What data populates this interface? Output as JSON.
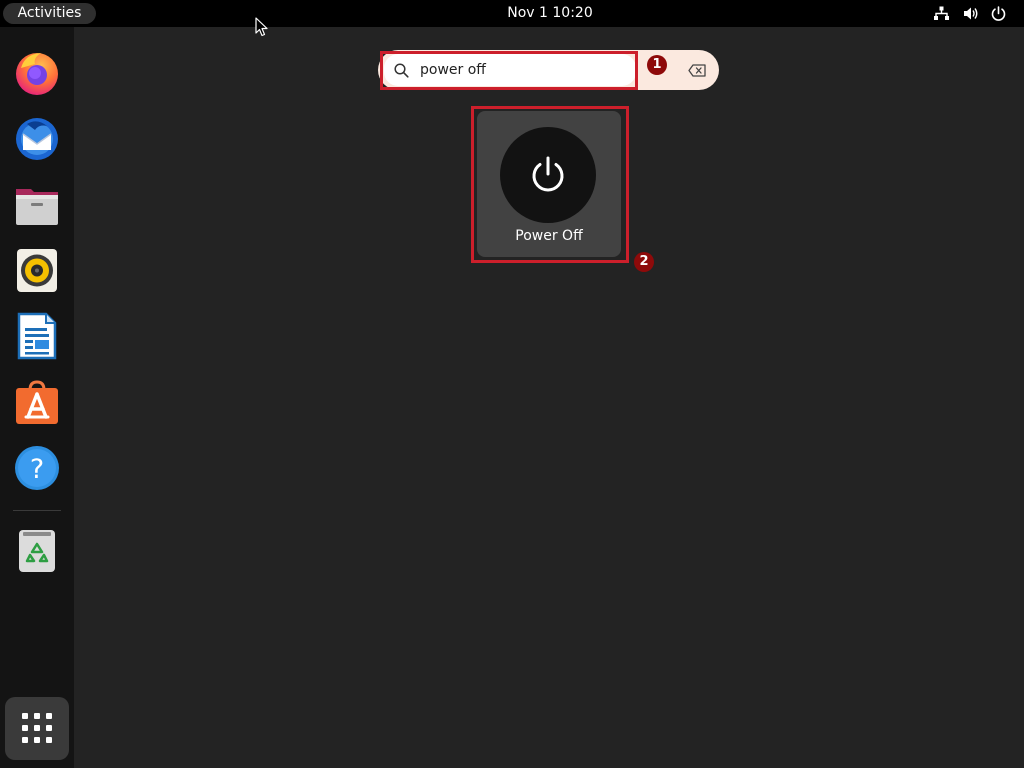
{
  "topbar": {
    "activities_label": "Activities",
    "clock": "Nov 1  10:20",
    "tray_icons": [
      "network-icon",
      "volume-icon",
      "power-icon"
    ]
  },
  "dock": {
    "apps": [
      {
        "name": "firefox",
        "icon": "firefox-icon"
      },
      {
        "name": "thunderbird",
        "icon": "thunderbird-icon"
      },
      {
        "name": "files",
        "icon": "files-icon"
      },
      {
        "name": "rhythmbox",
        "icon": "rhythmbox-icon"
      },
      {
        "name": "libreoffice-writer",
        "icon": "writer-icon"
      },
      {
        "name": "software",
        "icon": "app-store-icon"
      },
      {
        "name": "help",
        "icon": "help-icon"
      },
      {
        "name": "trash",
        "icon": "trash-icon"
      }
    ],
    "show_apps_icon": "app-grid-icon"
  },
  "search": {
    "value": "power off",
    "icon": "search-icon",
    "clear_icon": "backspace-clear-icon"
  },
  "results": [
    {
      "label": "Power Off",
      "icon": "power-icon"
    }
  ],
  "annotations": {
    "badge_1": "1",
    "badge_2": "2",
    "highlight_color": "#cc1f2b",
    "badge_color": "#8e0a0a"
  },
  "colors": {
    "background": "#232323",
    "topbar": "#000000",
    "dock": "#141414",
    "tile": "#424242"
  }
}
